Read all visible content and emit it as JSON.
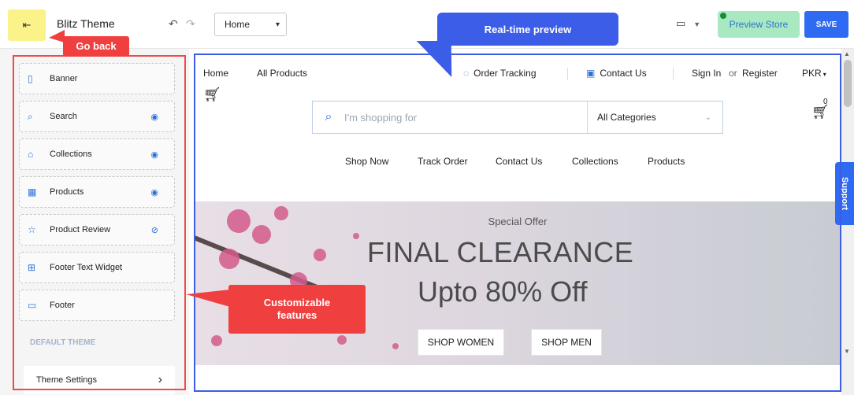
{
  "topbar": {
    "theme_name": "Blitz Theme",
    "page_select": "Home",
    "preview_store": "Preview Store",
    "save": "SAVE"
  },
  "sidebar": {
    "items": [
      {
        "label": "Banner",
        "icon": "banner-icon",
        "visible": null
      },
      {
        "label": "Search",
        "icon": "search-icon",
        "visible": true
      },
      {
        "label": "Collections",
        "icon": "collections-icon",
        "visible": true
      },
      {
        "label": "Products",
        "icon": "products-icon",
        "visible": true
      },
      {
        "label": "Product Review",
        "icon": "product-review-icon",
        "visible": false
      },
      {
        "label": "Footer Text Widget",
        "icon": "widget-icon",
        "visible": null
      },
      {
        "label": "Footer",
        "icon": "footer-icon",
        "visible": null
      }
    ],
    "section_title": "DEFAULT THEME",
    "theme_settings": "Theme Settings"
  },
  "preview": {
    "nav_left": [
      "Home",
      "All Products"
    ],
    "order_tracking": "Order Tracking",
    "contact_us": "Contact Us",
    "sign_in": "Sign In",
    "or": "or",
    "register": "Register",
    "currency": "PKR",
    "cart_count": "0",
    "search_placeholder": "I'm shopping for",
    "category": "All Categories",
    "menu": [
      "Shop Now",
      "Track Order",
      "Contact Us",
      "Collections",
      "Products"
    ],
    "banner": {
      "kicker": "Special Offer",
      "headline": "FINAL CLEARANCE",
      "subheadline": "Upto 80% Off",
      "buttons": [
        "SHOP WOMEN",
        "SHOP MEN"
      ]
    },
    "support": "Support"
  },
  "annotations": {
    "go_back": "Go back",
    "realtime": "Real-time preview",
    "customizable": "Customizable features"
  },
  "colors": {
    "accent_blue": "#2e6af2",
    "annotation_red": "#ef3f3f",
    "annotation_blue": "#3b5de7",
    "preview_store_bg": "#a9e9c2",
    "back_button_bg": "#fbf28a"
  }
}
